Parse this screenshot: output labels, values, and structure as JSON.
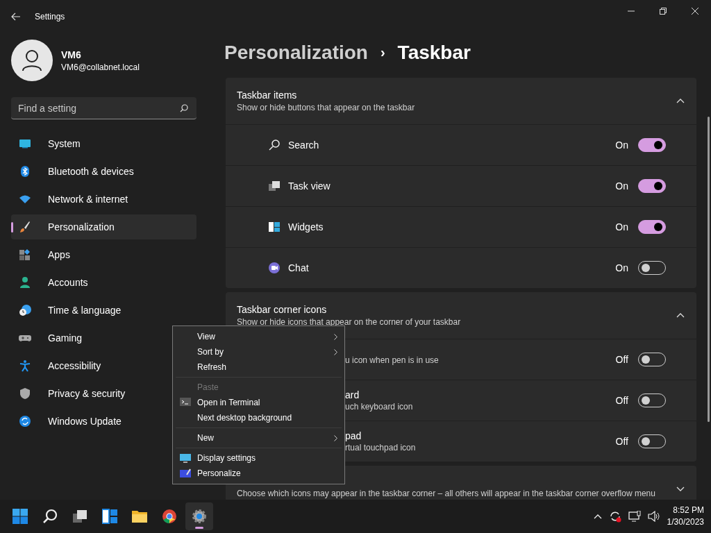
{
  "window": {
    "title": "Settings"
  },
  "profile": {
    "name": "VM6",
    "email": "VM6@collabnet.local"
  },
  "search": {
    "placeholder": "Find a setting"
  },
  "nav": [
    {
      "label": "System",
      "selected": false
    },
    {
      "label": "Bluetooth & devices",
      "selected": false
    },
    {
      "label": "Network & internet",
      "selected": false
    },
    {
      "label": "Personalization",
      "selected": true
    },
    {
      "label": "Apps",
      "selected": false
    },
    {
      "label": "Accounts",
      "selected": false
    },
    {
      "label": "Time & language",
      "selected": false
    },
    {
      "label": "Gaming",
      "selected": false
    },
    {
      "label": "Accessibility",
      "selected": false
    },
    {
      "label": "Privacy & security",
      "selected": false
    },
    {
      "label": "Windows Update",
      "selected": false
    }
  ],
  "breadcrumb": {
    "parent": "Personalization",
    "separator": "›",
    "current": "Taskbar"
  },
  "sections": [
    {
      "title": "Taskbar items",
      "subtitle": "Show or hide buttons that appear on the taskbar",
      "expanded": true,
      "rows": [
        {
          "label": "Search",
          "state": "On",
          "on": true
        },
        {
          "label": "Task view",
          "state": "On",
          "on": true
        },
        {
          "label": "Widgets",
          "state": "On",
          "on": true
        },
        {
          "label": "Chat",
          "state": "On",
          "on": false
        }
      ]
    },
    {
      "title": "Taskbar corner icons",
      "subtitle": "Show or hide icons that appear on the corner of your taskbar",
      "expanded": true,
      "rows": [
        {
          "desc": "u icon when pen is in use",
          "state": "Off",
          "on": false
        },
        {
          "label": "ard",
          "desc": "uch keyboard icon",
          "state": "Off",
          "on": false
        },
        {
          "label": "pad",
          "desc": "rtual touchpad icon",
          "state": "Off",
          "on": false
        }
      ]
    },
    {
      "subtitle": "Choose which icons may appear in the taskbar corner – all others will appear in the taskbar corner overflow menu",
      "expanded": false
    }
  ],
  "context_menu": {
    "groups": [
      [
        {
          "label": "View",
          "submenu": true,
          "disabled": false
        },
        {
          "label": "Sort by",
          "submenu": true,
          "disabled": false
        },
        {
          "label": "Refresh",
          "submenu": false,
          "disabled": false
        }
      ],
      [
        {
          "label": "Paste",
          "submenu": false,
          "disabled": true
        },
        {
          "label": "Open in Terminal",
          "submenu": false,
          "disabled": false
        },
        {
          "label": "Next desktop background",
          "submenu": false,
          "disabled": false
        }
      ],
      [
        {
          "label": "New",
          "submenu": true,
          "disabled": false
        }
      ],
      [
        {
          "label": "Display settings",
          "submenu": false,
          "disabled": false
        },
        {
          "label": "Personalize",
          "submenu": false,
          "disabled": false
        }
      ]
    ]
  },
  "taskbar": {
    "apps": [
      {
        "selected": false
      },
      {
        "selected": false
      },
      {
        "selected": false
      },
      {
        "selected": false
      },
      {
        "selected": false
      },
      {
        "selected": false
      },
      {
        "selected": true
      }
    ],
    "time": "8:52 PM",
    "date": "1/30/2023"
  }
}
